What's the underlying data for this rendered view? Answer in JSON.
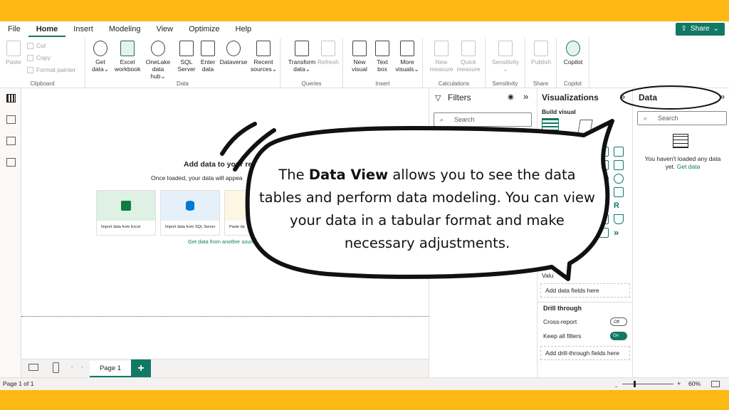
{
  "menu": {
    "items": [
      "File",
      "Home",
      "Insert",
      "Modeling",
      "View",
      "Optimize",
      "Help"
    ],
    "active": "Home",
    "share_label": "Share"
  },
  "ribbon": {
    "clipboard": {
      "paste": "Paste",
      "cut": "Cut",
      "copy": "Copy",
      "format_painter": "Format painter",
      "group": "Clipboard"
    },
    "data": {
      "get_data": [
        "Get",
        "data"
      ],
      "excel": [
        "Excel",
        "workbook"
      ],
      "onelake": [
        "OneLake",
        "data hub"
      ],
      "sql": [
        "SQL",
        "Server"
      ],
      "enter": [
        "Enter",
        "data"
      ],
      "dataverse": [
        "Dataverse",
        ""
      ],
      "recent": [
        "Recent",
        "sources"
      ],
      "group": "Data"
    },
    "queries": {
      "transform": [
        "Transform",
        "data"
      ],
      "refresh": [
        "Refresh",
        ""
      ],
      "group": "Queries"
    },
    "insert": {
      "new_visual": [
        "New",
        "visual"
      ],
      "text_box": [
        "Text",
        "box"
      ],
      "more_visuals": [
        "More",
        "visuals"
      ],
      "group": "Insert"
    },
    "calculations": {
      "new_measure": [
        "New",
        "measure"
      ],
      "quick_measure": [
        "Quick",
        "measure"
      ],
      "group": "Calculations"
    },
    "sensitivity": {
      "label": "Sensitivity",
      "group": "Sensitivity"
    },
    "share": {
      "publish": "Publish",
      "group": "Share"
    },
    "copilot": {
      "label": "Copilot",
      "group": "Copilot"
    }
  },
  "canvas": {
    "title": "Add data to your re",
    "subtitle": "Once loaded, your data will appea",
    "cards": [
      "Import data from Excel",
      "Import data from SQL Server",
      "Paste da"
    ],
    "get_data_link": "Get data from another source"
  },
  "pages": {
    "tab": "Page 1",
    "add": "+"
  },
  "status": {
    "page_info": "Page 1 of 1",
    "zoom": "60%"
  },
  "filters": {
    "title": "Filters",
    "search_placeholder": "Search"
  },
  "visualizations": {
    "title": "Visualizations",
    "build_visual": "Build visual",
    "values_label": "Valu",
    "add_data_fields": "Add data fields here",
    "drill_through": "Drill through",
    "cross_report": "Cross-report",
    "cross_report_state": "Off",
    "keep_all_filters": "Keep all filters",
    "keep_all_filters_state": "On",
    "add_drill_fields": "Add drill-through fields here"
  },
  "data_pane": {
    "title": "Data",
    "search_placeholder": "Search",
    "empty_message": "You haven't loaded any data yet.",
    "get_data_link": "Get data"
  },
  "callout": {
    "bold": "Data View",
    "prefix": "The",
    "rest": "allows you to see the data tables and perform data modeling. You can view your data in a tabular format and make necessary adjustments."
  },
  "colors": {
    "accent": "#117865",
    "frame": "#fdb813"
  }
}
